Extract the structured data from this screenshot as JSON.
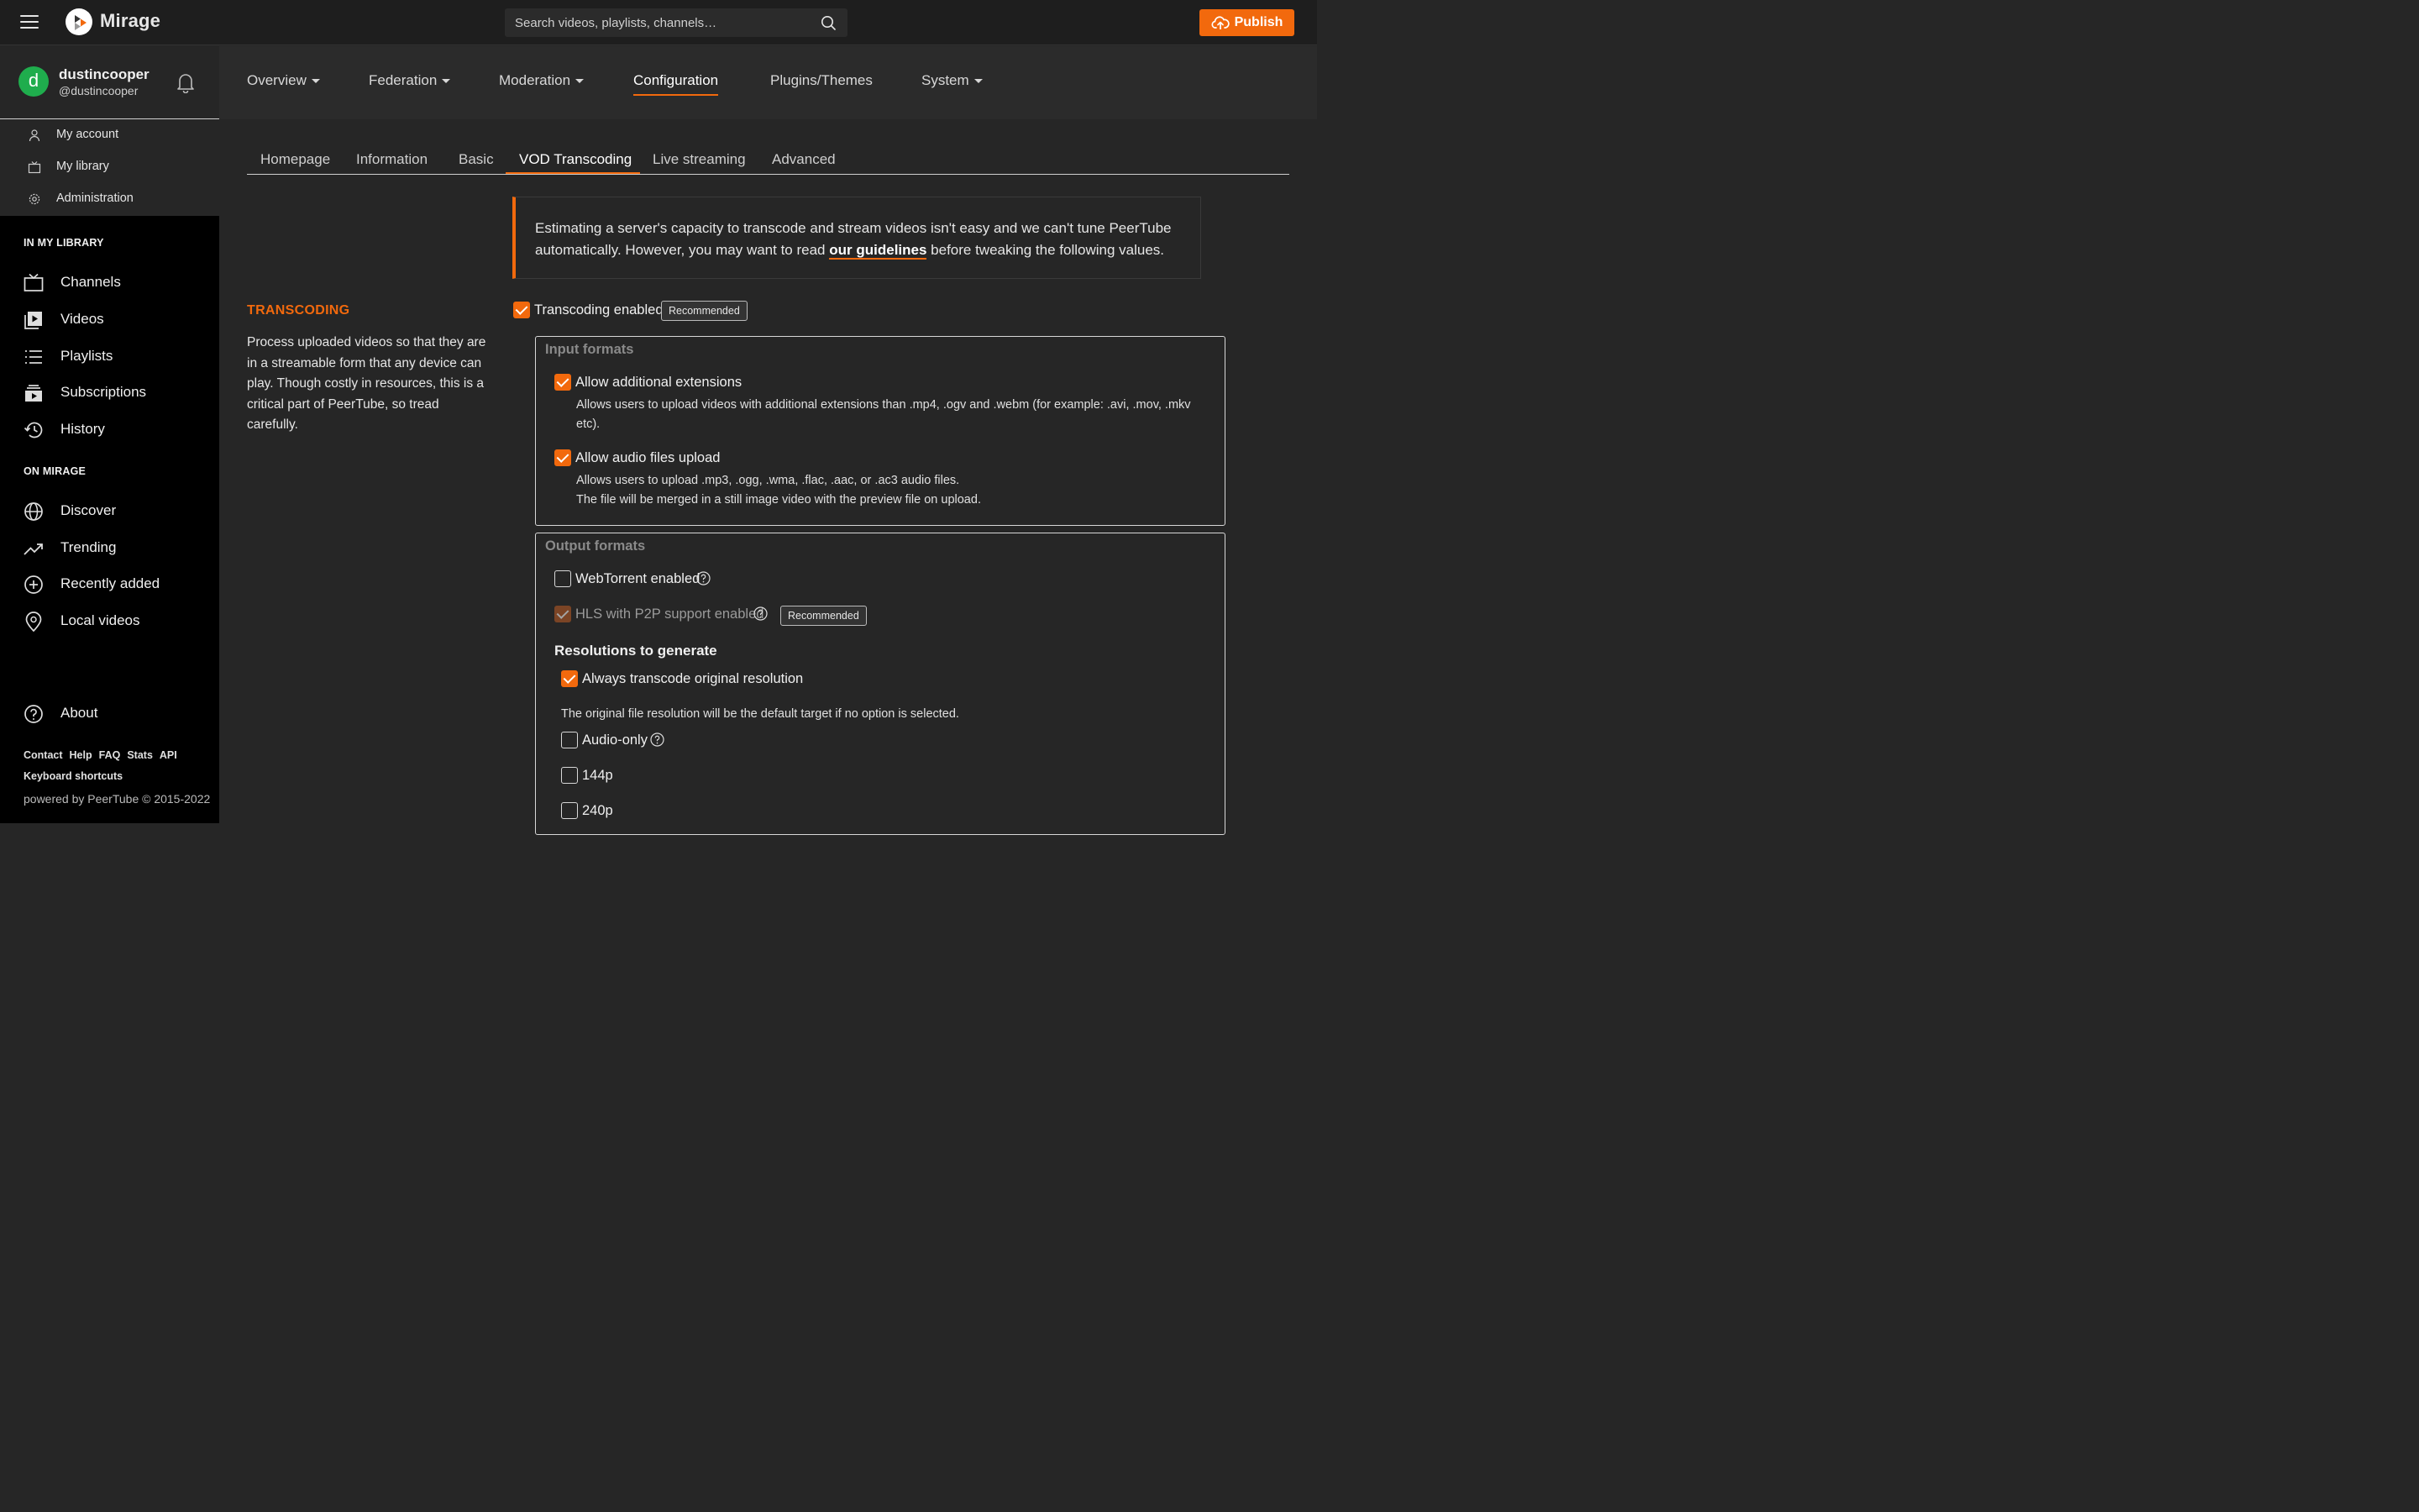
{
  "app": {
    "brand": "Mirage",
    "publish_label": "Publish",
    "search_placeholder": "Search videos, playlists, channels…"
  },
  "user": {
    "avatar_letter": "d",
    "name": "dustincooper",
    "handle": "@dustincooper"
  },
  "account_menu": [
    {
      "label": "My account",
      "icon": "user-icon"
    },
    {
      "label": "My library",
      "icon": "tv-icon"
    },
    {
      "label": "Administration",
      "icon": "gear-icon"
    }
  ],
  "sidebar": {
    "library_title": "IN MY LIBRARY",
    "library_items": [
      {
        "label": "Channels",
        "icon": "channels-icon"
      },
      {
        "label": "Videos",
        "icon": "videos-icon"
      },
      {
        "label": "Playlists",
        "icon": "playlists-icon"
      },
      {
        "label": "Subscriptions",
        "icon": "subscriptions-icon"
      },
      {
        "label": "History",
        "icon": "history-icon"
      }
    ],
    "instance_title": "ON MIRAGE",
    "instance_items": [
      {
        "label": "Discover",
        "icon": "globe-icon"
      },
      {
        "label": "Trending",
        "icon": "trending-icon"
      },
      {
        "label": "Recently added",
        "icon": "plus-circle-icon"
      },
      {
        "label": "Local videos",
        "icon": "location-icon"
      }
    ],
    "about_label": "About",
    "footer_links": [
      "Contact",
      "Help",
      "FAQ",
      "Stats",
      "API"
    ],
    "keyboard_shortcuts": "Keyboard shortcuts",
    "powered_by": "powered by PeerTube © 2015-2022"
  },
  "admin_tabs": [
    {
      "label": "Overview",
      "dropdown": true
    },
    {
      "label": "Federation",
      "dropdown": true
    },
    {
      "label": "Moderation",
      "dropdown": true
    },
    {
      "label": "Configuration",
      "dropdown": false,
      "active": true
    },
    {
      "label": "Plugins/Themes",
      "dropdown": false
    },
    {
      "label": "System",
      "dropdown": true
    }
  ],
  "config_tabs": [
    {
      "label": "Homepage"
    },
    {
      "label": "Information"
    },
    {
      "label": "Basic"
    },
    {
      "label": "VOD Transcoding",
      "active": true
    },
    {
      "label": "Live streaming"
    },
    {
      "label": "Advanced"
    }
  ],
  "alert": {
    "text_before": "Estimating a server's capacity to transcode and stream videos isn't easy and we can't tune PeerTube automatically. However, you may want to read ",
    "link": "our guidelines",
    "text_after": " before tweaking the following values."
  },
  "transcoding": {
    "title": "TRANSCODING",
    "description": "Process uploaded videos so that they are in a streamable form that any device can play. Though costly in resources, this is a critical part of PeerTube, so tread carefully.",
    "enabled_label": "Transcoding enabled",
    "enabled": true,
    "recommended_badge": "Recommended",
    "input_formats": {
      "legend": "Input formats",
      "allow_extensions_label": "Allow additional extensions",
      "allow_extensions": true,
      "allow_extensions_hint": "Allows users to upload videos with additional extensions than .mp4, .ogv and .webm (for example: .avi, .mov, .mkv etc).",
      "allow_audio_label": "Allow audio files upload",
      "allow_audio": true,
      "allow_audio_hint1": "Allows users to upload .mp3, .ogg, .wma, .flac, .aac, or .ac3 audio files.",
      "allow_audio_hint2": "The file will be merged in a still image video with the preview file on upload."
    },
    "output_formats": {
      "legend": "Output formats",
      "webtorrent_label": "WebTorrent enabled",
      "webtorrent": false,
      "hls_label": "HLS with P2P support enabled",
      "hls": true,
      "hls_badge": "Recommended",
      "resolutions_title": "Resolutions to generate",
      "always_original_label": "Always transcode original resolution",
      "always_original": true,
      "resolutions_hint": "The original file resolution will be the default target if no option is selected.",
      "audio_only_label": "Audio-only",
      "res_144_label": "144p",
      "res_240_label": "240p"
    }
  },
  "colors": {
    "accent": "#f2690d",
    "background": "#262626",
    "sidebar": "#000000",
    "topbar": "#1e1e1e"
  }
}
